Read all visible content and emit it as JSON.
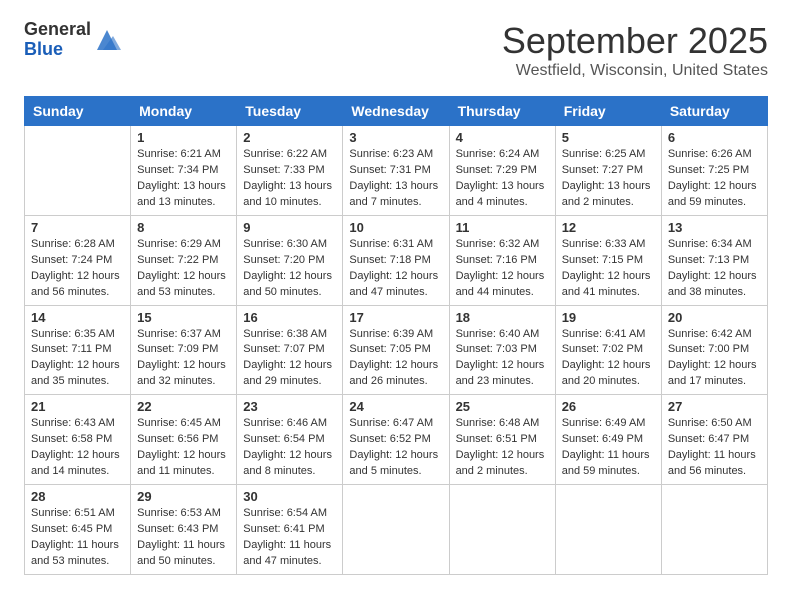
{
  "header": {
    "logo_general": "General",
    "logo_blue": "Blue",
    "month": "September 2025",
    "location": "Westfield, Wisconsin, United States"
  },
  "weekdays": [
    "Sunday",
    "Monday",
    "Tuesday",
    "Wednesday",
    "Thursday",
    "Friday",
    "Saturday"
  ],
  "weeks": [
    [
      {
        "day": "",
        "info": ""
      },
      {
        "day": "1",
        "info": "Sunrise: 6:21 AM\nSunset: 7:34 PM\nDaylight: 13 hours\nand 13 minutes."
      },
      {
        "day": "2",
        "info": "Sunrise: 6:22 AM\nSunset: 7:33 PM\nDaylight: 13 hours\nand 10 minutes."
      },
      {
        "day": "3",
        "info": "Sunrise: 6:23 AM\nSunset: 7:31 PM\nDaylight: 13 hours\nand 7 minutes."
      },
      {
        "day": "4",
        "info": "Sunrise: 6:24 AM\nSunset: 7:29 PM\nDaylight: 13 hours\nand 4 minutes."
      },
      {
        "day": "5",
        "info": "Sunrise: 6:25 AM\nSunset: 7:27 PM\nDaylight: 13 hours\nand 2 minutes."
      },
      {
        "day": "6",
        "info": "Sunrise: 6:26 AM\nSunset: 7:25 PM\nDaylight: 12 hours\nand 59 minutes."
      }
    ],
    [
      {
        "day": "7",
        "info": "Sunrise: 6:28 AM\nSunset: 7:24 PM\nDaylight: 12 hours\nand 56 minutes."
      },
      {
        "day": "8",
        "info": "Sunrise: 6:29 AM\nSunset: 7:22 PM\nDaylight: 12 hours\nand 53 minutes."
      },
      {
        "day": "9",
        "info": "Sunrise: 6:30 AM\nSunset: 7:20 PM\nDaylight: 12 hours\nand 50 minutes."
      },
      {
        "day": "10",
        "info": "Sunrise: 6:31 AM\nSunset: 7:18 PM\nDaylight: 12 hours\nand 47 minutes."
      },
      {
        "day": "11",
        "info": "Sunrise: 6:32 AM\nSunset: 7:16 PM\nDaylight: 12 hours\nand 44 minutes."
      },
      {
        "day": "12",
        "info": "Sunrise: 6:33 AM\nSunset: 7:15 PM\nDaylight: 12 hours\nand 41 minutes."
      },
      {
        "day": "13",
        "info": "Sunrise: 6:34 AM\nSunset: 7:13 PM\nDaylight: 12 hours\nand 38 minutes."
      }
    ],
    [
      {
        "day": "14",
        "info": "Sunrise: 6:35 AM\nSunset: 7:11 PM\nDaylight: 12 hours\nand 35 minutes."
      },
      {
        "day": "15",
        "info": "Sunrise: 6:37 AM\nSunset: 7:09 PM\nDaylight: 12 hours\nand 32 minutes."
      },
      {
        "day": "16",
        "info": "Sunrise: 6:38 AM\nSunset: 7:07 PM\nDaylight: 12 hours\nand 29 minutes."
      },
      {
        "day": "17",
        "info": "Sunrise: 6:39 AM\nSunset: 7:05 PM\nDaylight: 12 hours\nand 26 minutes."
      },
      {
        "day": "18",
        "info": "Sunrise: 6:40 AM\nSunset: 7:03 PM\nDaylight: 12 hours\nand 23 minutes."
      },
      {
        "day": "19",
        "info": "Sunrise: 6:41 AM\nSunset: 7:02 PM\nDaylight: 12 hours\nand 20 minutes."
      },
      {
        "day": "20",
        "info": "Sunrise: 6:42 AM\nSunset: 7:00 PM\nDaylight: 12 hours\nand 17 minutes."
      }
    ],
    [
      {
        "day": "21",
        "info": "Sunrise: 6:43 AM\nSunset: 6:58 PM\nDaylight: 12 hours\nand 14 minutes."
      },
      {
        "day": "22",
        "info": "Sunrise: 6:45 AM\nSunset: 6:56 PM\nDaylight: 12 hours\nand 11 minutes."
      },
      {
        "day": "23",
        "info": "Sunrise: 6:46 AM\nSunset: 6:54 PM\nDaylight: 12 hours\nand 8 minutes."
      },
      {
        "day": "24",
        "info": "Sunrise: 6:47 AM\nSunset: 6:52 PM\nDaylight: 12 hours\nand 5 minutes."
      },
      {
        "day": "25",
        "info": "Sunrise: 6:48 AM\nSunset: 6:51 PM\nDaylight: 12 hours\nand 2 minutes."
      },
      {
        "day": "26",
        "info": "Sunrise: 6:49 AM\nSunset: 6:49 PM\nDaylight: 11 hours\nand 59 minutes."
      },
      {
        "day": "27",
        "info": "Sunrise: 6:50 AM\nSunset: 6:47 PM\nDaylight: 11 hours\nand 56 minutes."
      }
    ],
    [
      {
        "day": "28",
        "info": "Sunrise: 6:51 AM\nSunset: 6:45 PM\nDaylight: 11 hours\nand 53 minutes."
      },
      {
        "day": "29",
        "info": "Sunrise: 6:53 AM\nSunset: 6:43 PM\nDaylight: 11 hours\nand 50 minutes."
      },
      {
        "day": "30",
        "info": "Sunrise: 6:54 AM\nSunset: 6:41 PM\nDaylight: 11 hours\nand 47 minutes."
      },
      {
        "day": "",
        "info": ""
      },
      {
        "day": "",
        "info": ""
      },
      {
        "day": "",
        "info": ""
      },
      {
        "day": "",
        "info": ""
      }
    ]
  ]
}
